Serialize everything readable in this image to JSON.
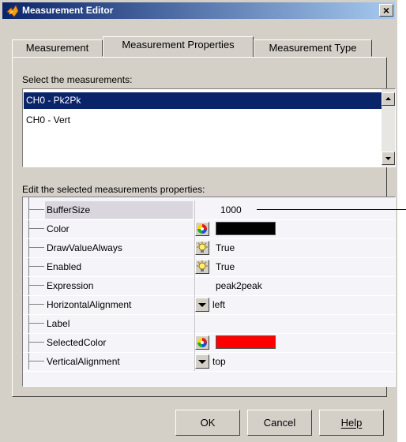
{
  "window": {
    "title": "Measurement Editor",
    "close_glyph": "×"
  },
  "tabs": [
    {
      "label": "Measurement",
      "active": false
    },
    {
      "label": "Measurement Properties",
      "active": true
    },
    {
      "label": "Measurement Type",
      "active": false
    }
  ],
  "select_section": {
    "label": "Select the measurements:",
    "items": [
      {
        "label": "CH0 - Pk2Pk",
        "selected": true
      },
      {
        "label": "CH0 - Vert",
        "selected": false
      }
    ]
  },
  "properties_section": {
    "label": "Edit the selected measurements properties:",
    "rows": [
      {
        "name": "BufferSize",
        "value": "1000",
        "editor": "text",
        "highlighted": true
      },
      {
        "name": "Color",
        "value": "",
        "editor": "color",
        "swatch": "#000000"
      },
      {
        "name": "DrawValueAlways",
        "value": "True",
        "editor": "bool",
        "icon": "bulb-icon"
      },
      {
        "name": "Enabled",
        "value": "True",
        "editor": "bool",
        "icon": "bulb-icon"
      },
      {
        "name": "Expression",
        "value": "peak2peak",
        "editor": "text"
      },
      {
        "name": "HorizontalAlignment",
        "value": "left",
        "editor": "dropdown"
      },
      {
        "name": "Label",
        "value": "",
        "editor": "text"
      },
      {
        "name": "SelectedColor",
        "value": "",
        "editor": "color",
        "swatch": "#ff0000"
      },
      {
        "name": "VerticalAlignment",
        "value": "top",
        "editor": "dropdown"
      }
    ]
  },
  "buttons": {
    "ok": "OK",
    "cancel": "Cancel",
    "help": "Help"
  },
  "colors": {
    "title_active": "#0a246a",
    "selection": "#0a246a",
    "face": "#d4d0c8"
  }
}
